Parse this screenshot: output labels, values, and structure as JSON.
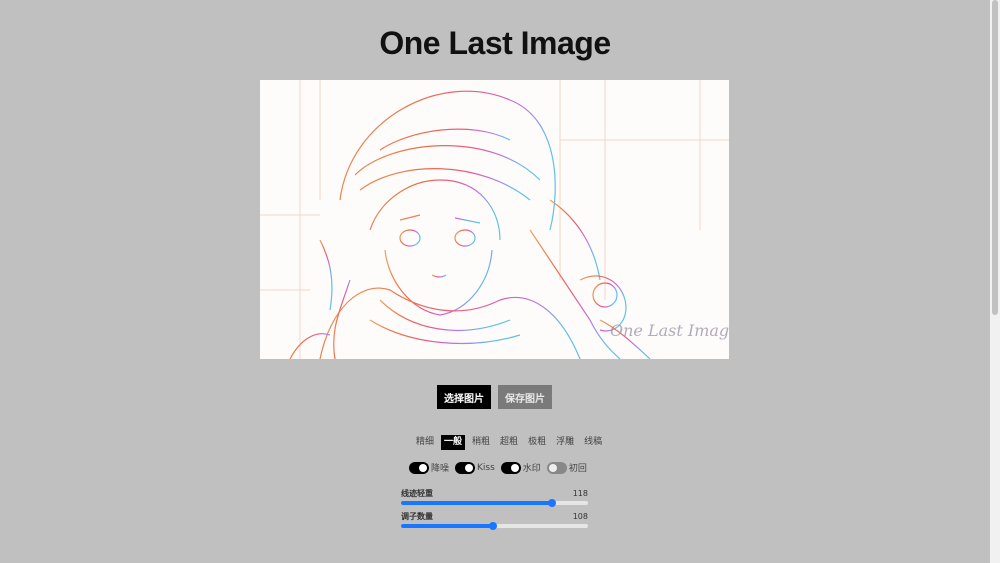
{
  "title": "One Last Image",
  "buttons": {
    "select": "选择图片",
    "save": "保存图片"
  },
  "styles": [
    {
      "label": "精细",
      "active": false
    },
    {
      "label": "一般",
      "active": true
    },
    {
      "label": "稍粗",
      "active": false
    },
    {
      "label": "超粗",
      "active": false
    },
    {
      "label": "极粗",
      "active": false
    },
    {
      "label": "浮雕",
      "active": false
    },
    {
      "label": "线稿",
      "active": false
    }
  ],
  "toggles": [
    {
      "label": "降噪",
      "on": true
    },
    {
      "label": "Kiss",
      "on": true
    },
    {
      "label": "水印",
      "on": true
    },
    {
      "label": "初回",
      "on": false
    }
  ],
  "sliders": [
    {
      "label": "线迹轻重",
      "value": "118",
      "fraction": 0.81
    },
    {
      "label": "调子数量",
      "value": "108",
      "fraction": 0.49
    }
  ],
  "watermark": "One Last Image",
  "colors": {
    "background": "#c0c0c0",
    "accent": "#1976ff",
    "primary_button": "#000000",
    "secondary_button": "#7a7a7a"
  }
}
